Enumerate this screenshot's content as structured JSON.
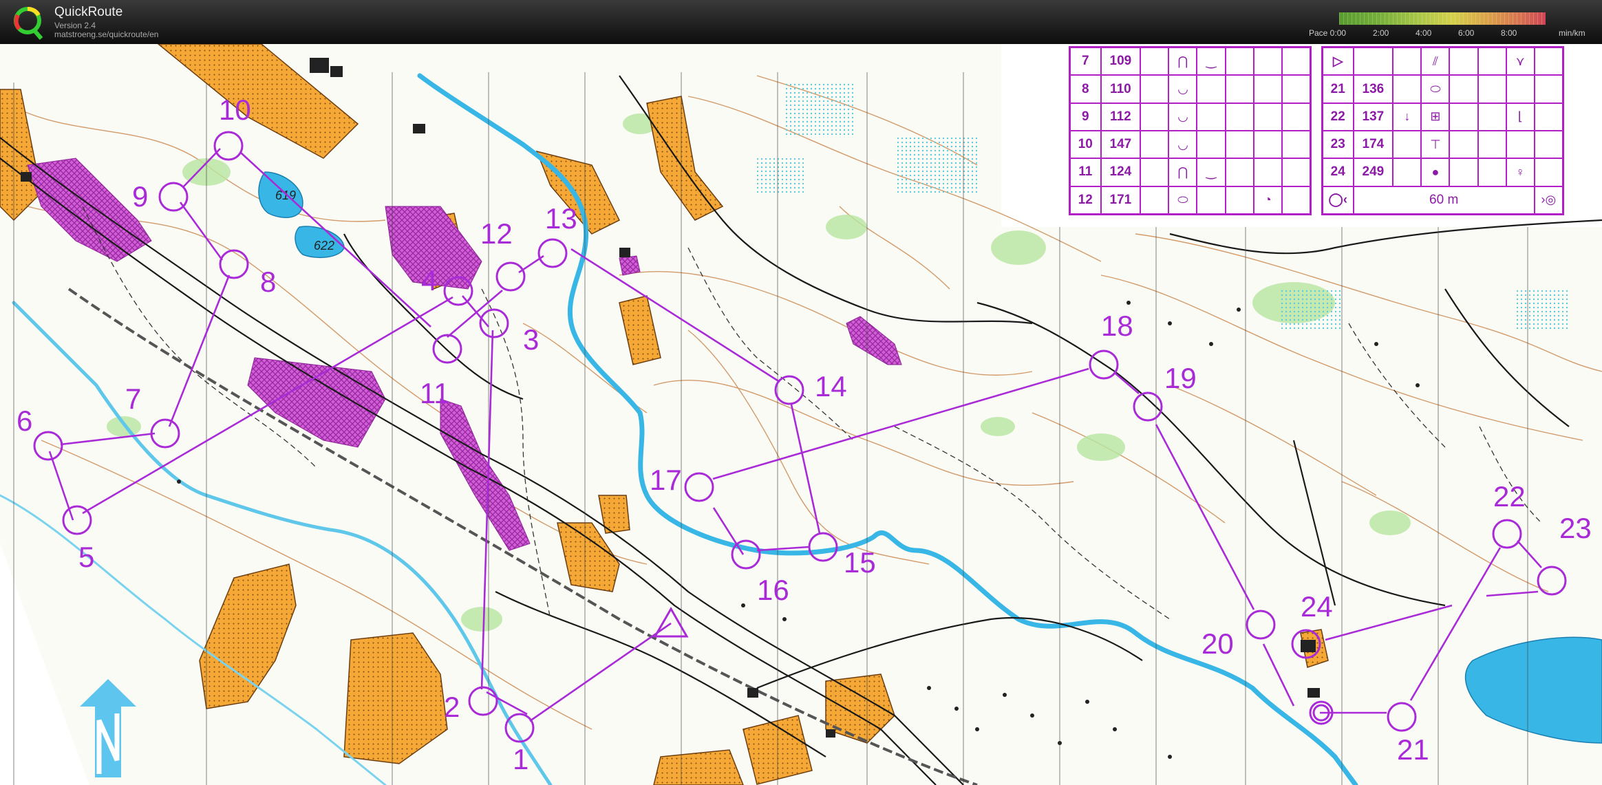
{
  "app": {
    "title": "QuickRoute",
    "version": "Version 2.4",
    "url": "matstroeng.se/quickroute/en"
  },
  "pace_scale": {
    "labels": [
      "Pace 0:00",
      "2:00",
      "4:00",
      "6:00",
      "8:00"
    ],
    "unit": "min/km"
  },
  "colors": {
    "course": "#a92ad7",
    "water": "#38b6e6",
    "open": "#f6a836",
    "forbidden": "#c93ab8"
  },
  "legend_left": [
    {
      "num": "7",
      "code": "109",
      "s1": "⋂",
      "s2": "‿"
    },
    {
      "num": "8",
      "code": "110",
      "s1": "◡",
      "s2": ""
    },
    {
      "num": "9",
      "code": "112",
      "s1": "◡",
      "s2": ""
    },
    {
      "num": "10",
      "code": "147",
      "s1": "◡",
      "s2": ""
    },
    {
      "num": "11",
      "code": "124",
      "s1": "⋂",
      "s2": "‿"
    },
    {
      "num": "12",
      "code": "171",
      "s1": "⬭",
      "s2": "",
      "s3": "◔"
    }
  ],
  "legend_right": [
    {
      "num": "21",
      "code": "136",
      "s1": "",
      "s2": "⬭"
    },
    {
      "num": "22",
      "code": "137",
      "s1": "↓",
      "s2": "⊞"
    },
    {
      "num": "23",
      "code": "174",
      "s1": "",
      "s2": "⊤"
    },
    {
      "num": "24",
      "code": "249",
      "s1": "",
      "s2": "●"
    }
  ],
  "legend_right_start": "▷",
  "legend_finish_distance": "60 m",
  "controls": [
    {
      "n": "1"
    },
    {
      "n": "2"
    },
    {
      "n": "3"
    },
    {
      "n": "4"
    },
    {
      "n": "5"
    },
    {
      "n": "6"
    },
    {
      "n": "7"
    },
    {
      "n": "8"
    },
    {
      "n": "9"
    },
    {
      "n": "10"
    },
    {
      "n": "11"
    },
    {
      "n": "12"
    },
    {
      "n": "13"
    },
    {
      "n": "14"
    },
    {
      "n": "15"
    },
    {
      "n": "16"
    },
    {
      "n": "17"
    },
    {
      "n": "18"
    },
    {
      "n": "19"
    },
    {
      "n": "20"
    },
    {
      "n": "21"
    },
    {
      "n": "22"
    },
    {
      "n": "23"
    },
    {
      "n": "24"
    }
  ],
  "spot_heights": [
    "619",
    "622"
  ]
}
